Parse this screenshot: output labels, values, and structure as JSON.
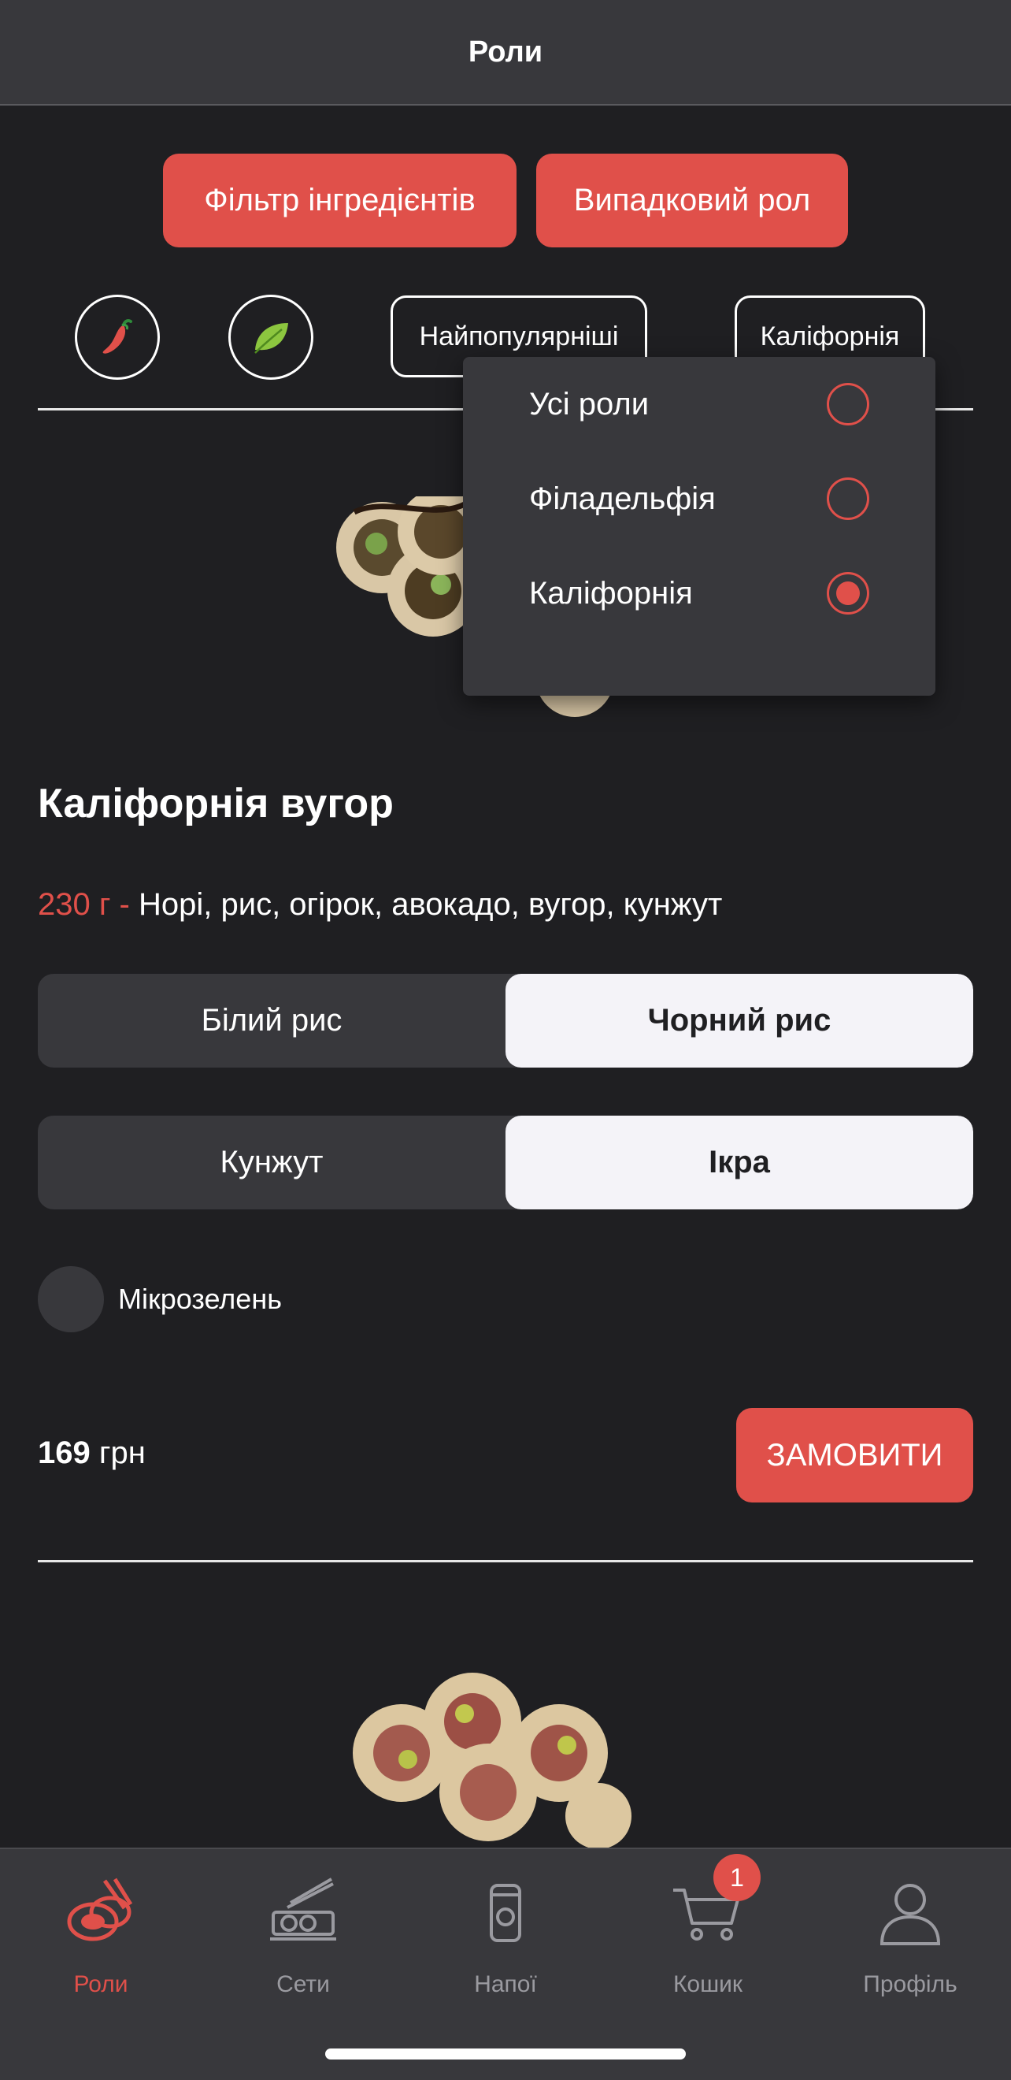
{
  "header": {
    "title": "Роли"
  },
  "actions": {
    "filter_label": "Фільтр інгредієнтів",
    "random_label": "Випадковий рол"
  },
  "filters": {
    "spicy_icon": "chili-pepper-icon",
    "vegan_icon": "leaf-icon",
    "sort_label": "Найпопулярніші",
    "category_label": "Каліфорнія"
  },
  "dropdown": {
    "options": [
      {
        "label": "Усі роли",
        "selected": false
      },
      {
        "label": "Філадельфія",
        "selected": false
      },
      {
        "label": "Каліфорнія",
        "selected": true
      }
    ]
  },
  "product": {
    "title": "Каліфорнія вугор",
    "weight": "230 г -",
    "ingredients": "Норі, рис, огірок, авокадо, вугор, кунжут",
    "rice_options": [
      "Білий рис",
      "Чорний рис"
    ],
    "rice_selected": 1,
    "topping_options": [
      "Кунжут",
      "Ікра"
    ],
    "topping_selected": 1,
    "extra_label": "Мікрозелень",
    "extra_checked": false,
    "price_value": "169",
    "price_currency": "грн",
    "order_label": "ЗАМОВИТИ"
  },
  "tabs": [
    {
      "label": "Роли",
      "icon": "sushi-roll-icon",
      "active": true
    },
    {
      "label": "Сети",
      "icon": "sushi-set-icon",
      "active": false
    },
    {
      "label": "Напої",
      "icon": "drink-can-icon",
      "active": false
    },
    {
      "label": "Кошик",
      "icon": "cart-icon",
      "active": false
    },
    {
      "label": "Профіль",
      "icon": "user-icon",
      "active": false
    }
  ],
  "cart_badge": "1",
  "colors": {
    "accent": "#e0504a",
    "background": "#1f1f22",
    "surface": "#38383c"
  }
}
